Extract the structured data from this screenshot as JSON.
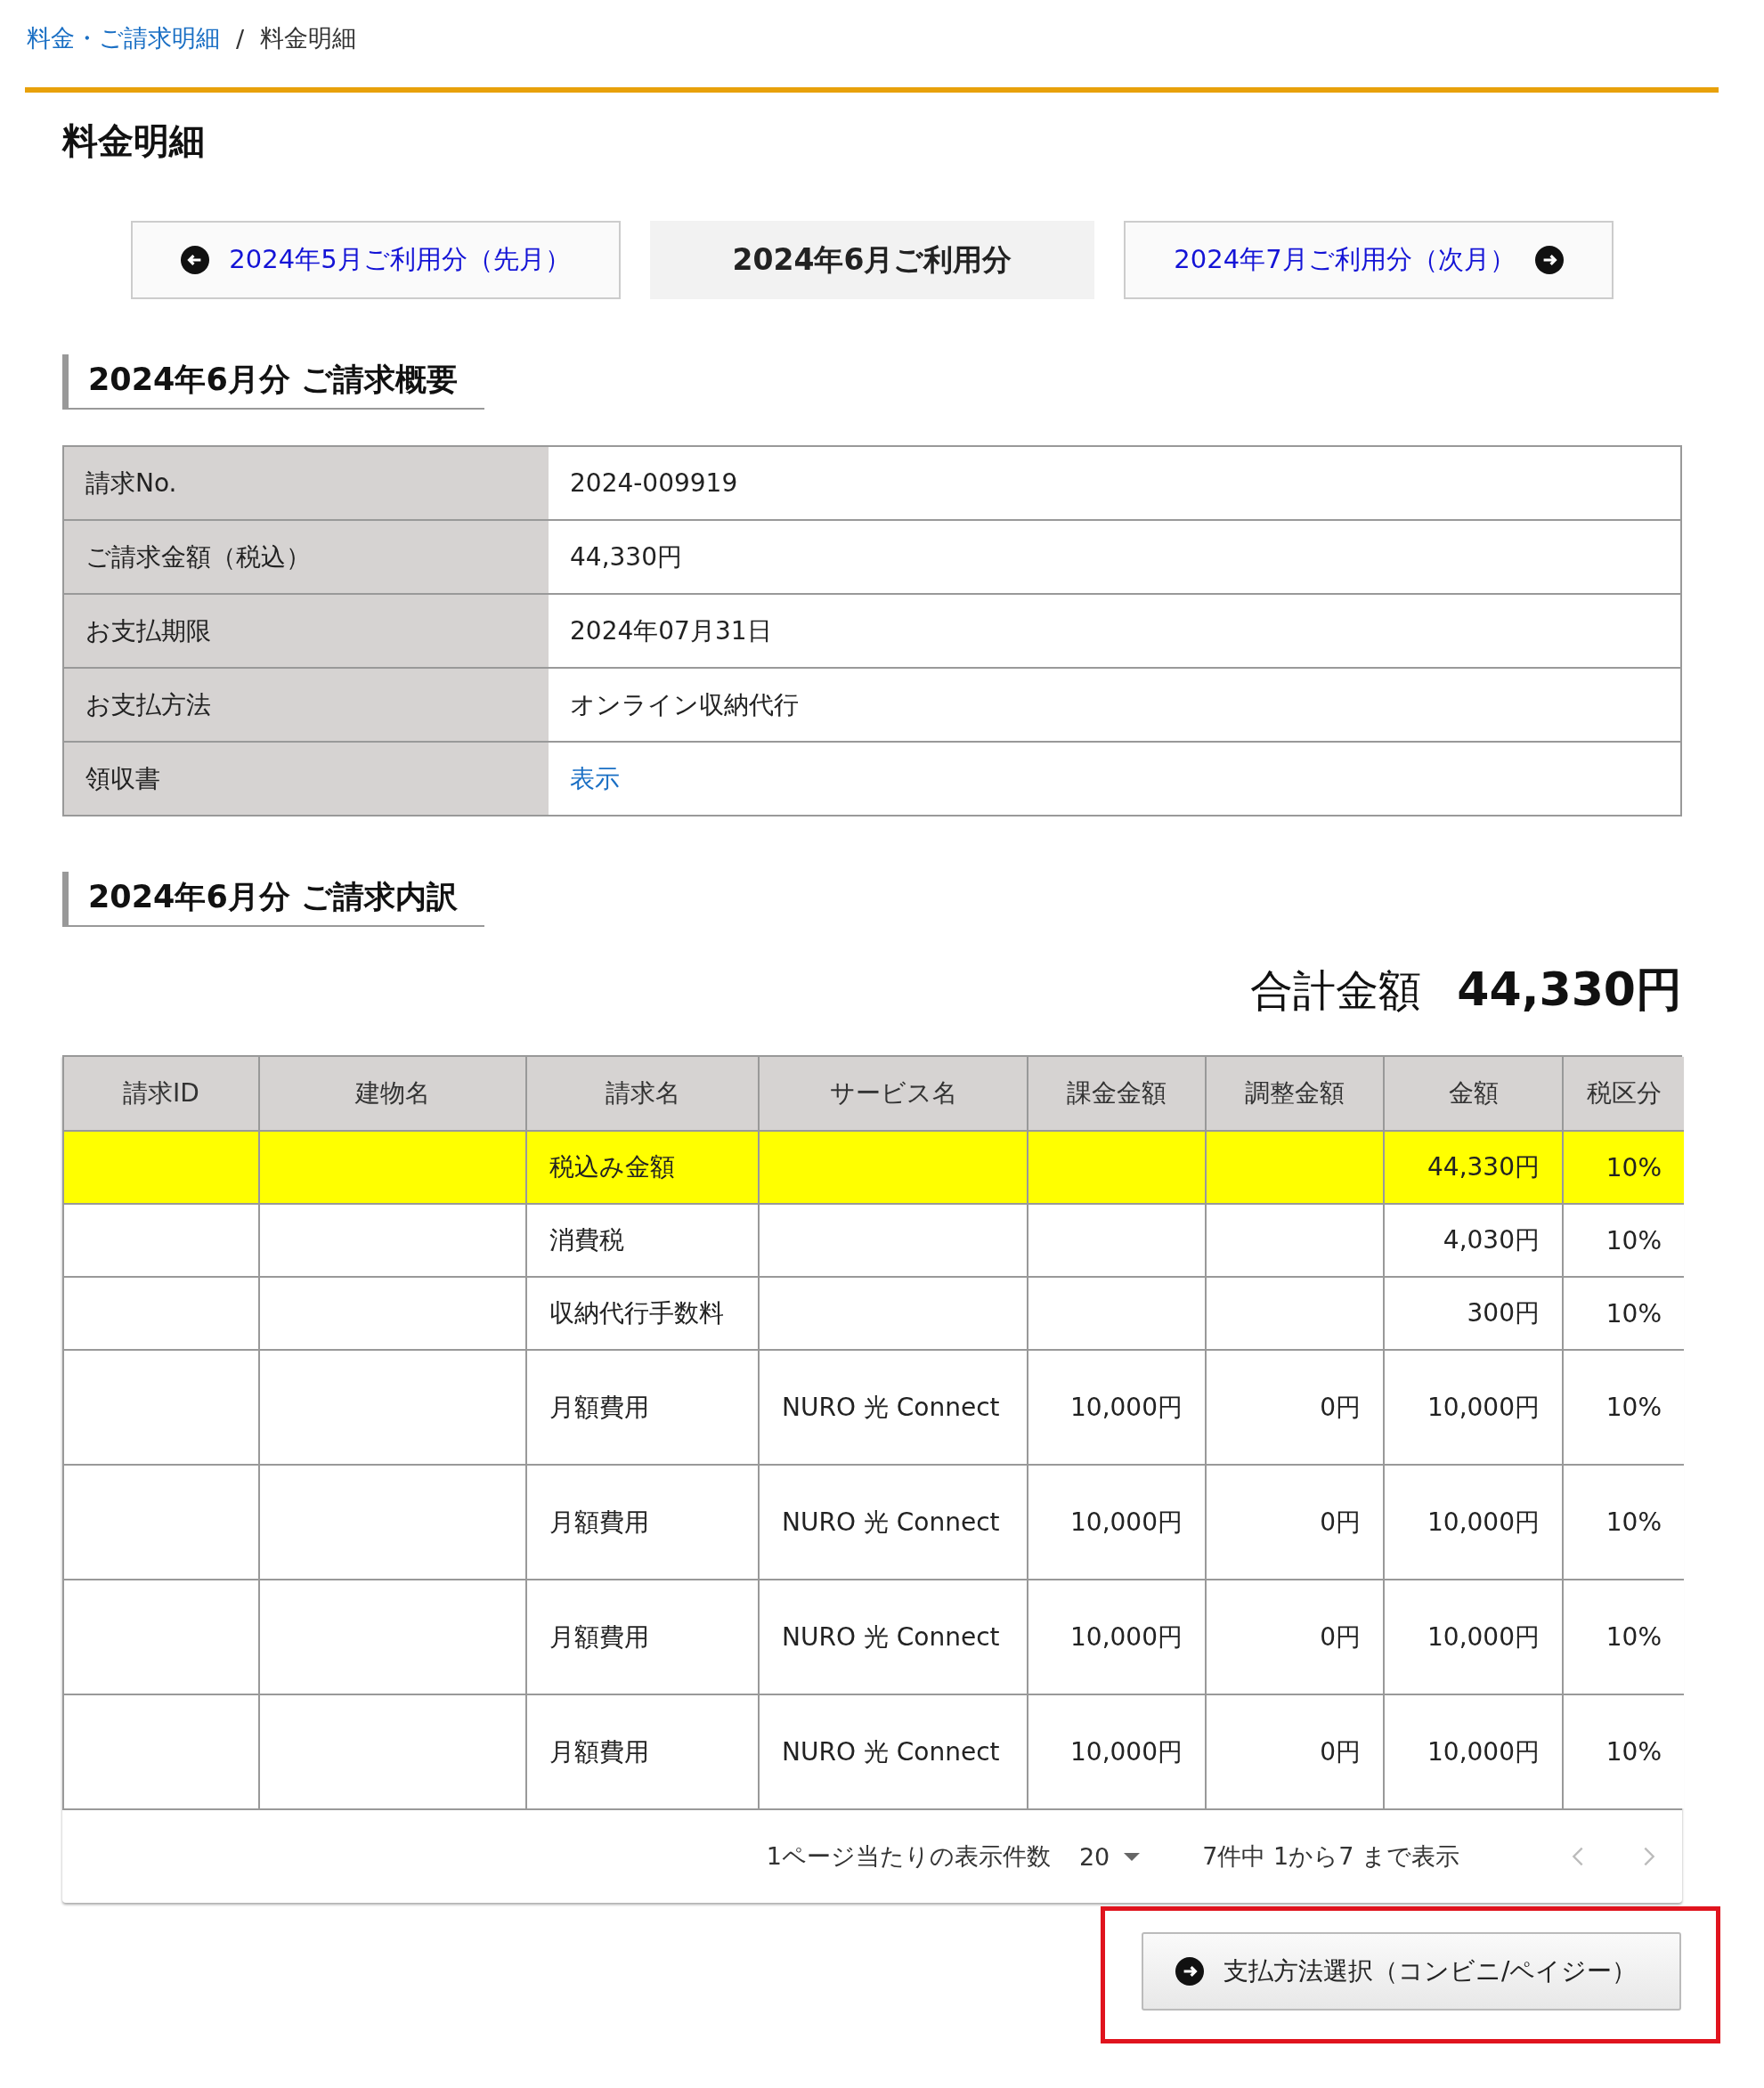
{
  "breadcrumb": [
    {
      "label": "料金・ご請求明細",
      "link": true
    },
    {
      "label": "/",
      "link": false
    },
    {
      "label": "料金明細",
      "link": false
    }
  ],
  "page_title": "料金明細",
  "month_nav": [
    {
      "label": "2024年5月ご利用分（先月）",
      "kind": "prev",
      "selected": false
    },
    {
      "label": "2024年6月ご利用分",
      "kind": "current",
      "selected": true
    },
    {
      "label": "2024年7月ご利用分（次月）",
      "kind": "next",
      "selected": false
    }
  ],
  "summary": {
    "heading": "2024年6月分 ご請求概要",
    "rows": [
      {
        "label": "請求No.",
        "value": "2024-009919",
        "link": false
      },
      {
        "label": "ご請求金額（税込）",
        "value": "44,330円",
        "link": false
      },
      {
        "label": "お支払期限",
        "value": "2024年07月31日",
        "link": false
      },
      {
        "label": "お支払方法",
        "value": "オンライン収納代行",
        "link": false
      },
      {
        "label": "領収書",
        "value": "表示",
        "link": true
      }
    ]
  },
  "breakdown": {
    "heading": "2024年6月分 ご請求内訳",
    "total_label": "合計金額",
    "total_value": "44,330円",
    "table": {
      "columns": [
        "請求ID",
        "建物名",
        "請求名",
        "サービス名",
        "課金金額",
        "調整金額",
        "金額",
        "税区分"
      ],
      "rows": [
        {
          "highlighted": true,
          "cells": [
            "",
            "",
            "税込み金額",
            "",
            "",
            "",
            "44,330円",
            "10%"
          ]
        },
        {
          "highlighted": false,
          "cells": [
            "",
            "",
            "消費税",
            "",
            "",
            "",
            "4,030円",
            "10%"
          ]
        },
        {
          "highlighted": false,
          "cells": [
            "",
            "",
            "収納代行手数料",
            "",
            "",
            "",
            "300円",
            "10%"
          ]
        },
        {
          "highlighted": false,
          "cells": [
            "",
            "",
            "月額費用",
            "NURO 光 Connect",
            "10,000円",
            "0円",
            "10,000円",
            "10%"
          ]
        },
        {
          "highlighted": false,
          "cells": [
            "",
            "",
            "月額費用",
            "NURO 光 Connect",
            "10,000円",
            "0円",
            "10,000円",
            "10%"
          ]
        },
        {
          "highlighted": false,
          "cells": [
            "",
            "",
            "月額費用",
            "NURO 光 Connect",
            "10,000円",
            "0円",
            "10,000円",
            "10%"
          ]
        },
        {
          "highlighted": false,
          "cells": [
            "",
            "",
            "月額費用",
            "NURO 光 Connect",
            "10,000円",
            "0円",
            "10,000円",
            "10%"
          ]
        }
      ]
    },
    "pagination": {
      "per_page_label": "1ページ当たりの表示件数",
      "per_page": "20",
      "range": "7件中 1から7 まで表示",
      "prev_disabled": true,
      "next_disabled": true
    }
  },
  "payment_button": {
    "label": "支払方法選択（コンビニ/ペイジー）",
    "highlighted": true
  }
}
